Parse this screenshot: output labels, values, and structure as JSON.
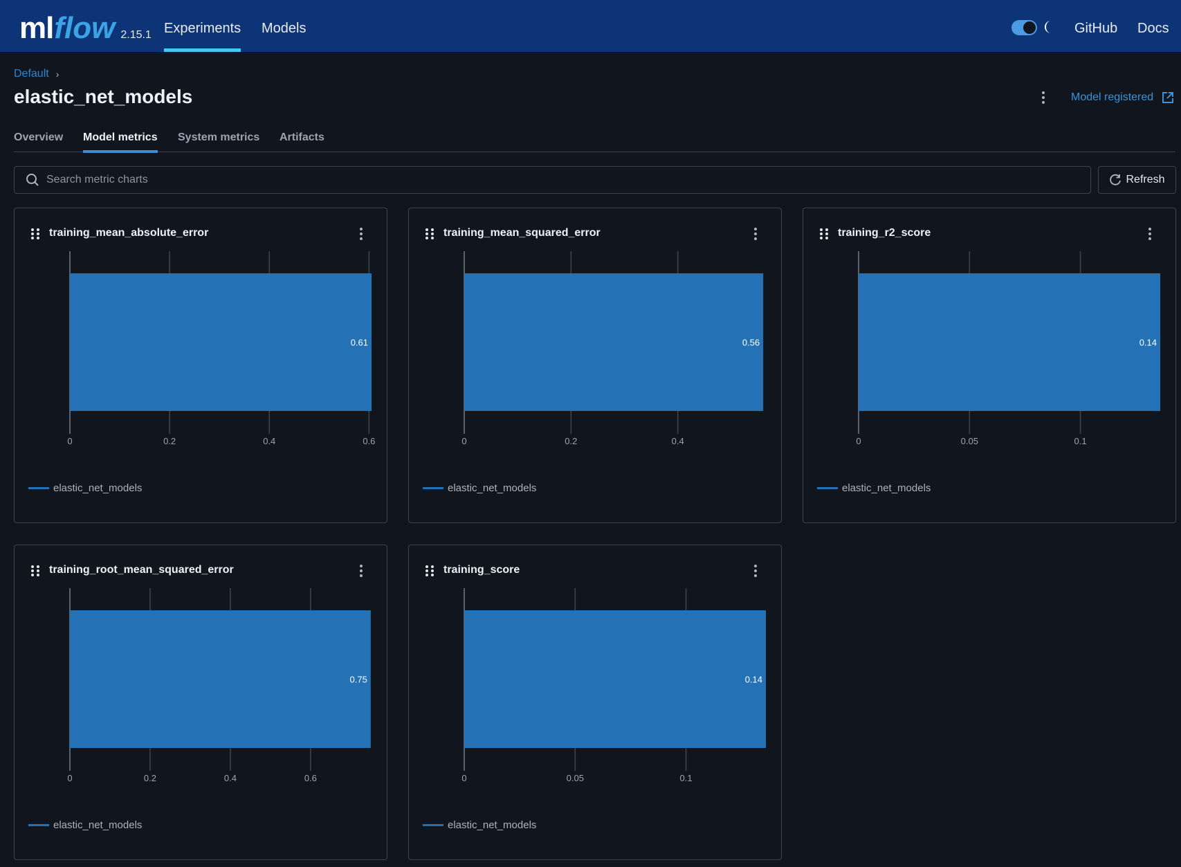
{
  "header": {
    "logo_ml": "ml",
    "logo_flow": "flow",
    "version": "2.15.1",
    "nav": [
      {
        "label": "Experiments",
        "active": true
      },
      {
        "label": "Models",
        "active": false
      }
    ],
    "theme_toggle_on": true,
    "links": [
      "GitHub",
      "Docs"
    ]
  },
  "breadcrumb": {
    "items": [
      "Default"
    ]
  },
  "page": {
    "title": "elastic_net_models",
    "model_registered_label": "Model registered"
  },
  "tabs": [
    {
      "label": "Overview",
      "active": false
    },
    {
      "label": "Model metrics",
      "active": true
    },
    {
      "label": "System metrics",
      "active": false
    },
    {
      "label": "Artifacts",
      "active": false
    }
  ],
  "search": {
    "placeholder": "Search metric charts",
    "value": ""
  },
  "refresh_label": "Refresh",
  "colors": {
    "bar": "#2471b5",
    "accent": "#43c8ee",
    "link": "#3a93da"
  },
  "chart_data": [
    {
      "type": "bar",
      "orientation": "horizontal",
      "title": "training_mean_absolute_error",
      "categories": [
        "elastic_net_models"
      ],
      "values": [
        0.61
      ],
      "value_labels": [
        "0.61"
      ],
      "xticks": [
        "0",
        "0.2",
        "0.4",
        "0.6"
      ],
      "xtick_values": [
        0,
        0.2,
        0.4,
        0.6
      ],
      "xlim": [
        0,
        0.605
      ],
      "legend": [
        "elastic_net_models"
      ],
      "legend_position": "bottom-left",
      "grid": true
    },
    {
      "type": "bar",
      "orientation": "horizontal",
      "title": "training_mean_squared_error",
      "categories": [
        "elastic_net_models"
      ],
      "values": [
        0.56
      ],
      "value_labels": [
        "0.56"
      ],
      "xticks": [
        "0",
        "0.2",
        "0.4"
      ],
      "xtick_values": [
        0,
        0.2,
        0.4
      ],
      "xlim": [
        0,
        0.565
      ],
      "legend": [
        "elastic_net_models"
      ],
      "legend_position": "bottom-left",
      "grid": true
    },
    {
      "type": "bar",
      "orientation": "horizontal",
      "title": "training_r2_score",
      "categories": [
        "elastic_net_models"
      ],
      "values": [
        0.14
      ],
      "value_labels": [
        "0.14"
      ],
      "xticks": [
        "0",
        "0.05",
        "0.1"
      ],
      "xtick_values": [
        0,
        0.05,
        0.1
      ],
      "xlim": [
        0,
        0.136
      ],
      "legend": [
        "elastic_net_models"
      ],
      "legend_position": "bottom-left",
      "grid": true
    },
    {
      "type": "bar",
      "orientation": "horizontal",
      "title": "training_root_mean_squared_error",
      "categories": [
        "elastic_net_models"
      ],
      "values": [
        0.75
      ],
      "value_labels": [
        "0.75"
      ],
      "xticks": [
        "0",
        "0.2",
        "0.4",
        "0.6"
      ],
      "xtick_values": [
        0,
        0.2,
        0.4,
        0.6
      ],
      "xlim": [
        0,
        0.752
      ],
      "legend": [
        "elastic_net_models"
      ],
      "legend_position": "bottom-left",
      "grid": true
    },
    {
      "type": "bar",
      "orientation": "horizontal",
      "title": "training_score",
      "categories": [
        "elastic_net_models"
      ],
      "values": [
        0.14
      ],
      "value_labels": [
        "0.14"
      ],
      "xticks": [
        "0",
        "0.05",
        "0.1"
      ],
      "xtick_values": [
        0,
        0.05,
        0.1
      ],
      "xlim": [
        0,
        0.136
      ],
      "legend": [
        "elastic_net_models"
      ],
      "legend_position": "bottom-left",
      "grid": true
    }
  ]
}
